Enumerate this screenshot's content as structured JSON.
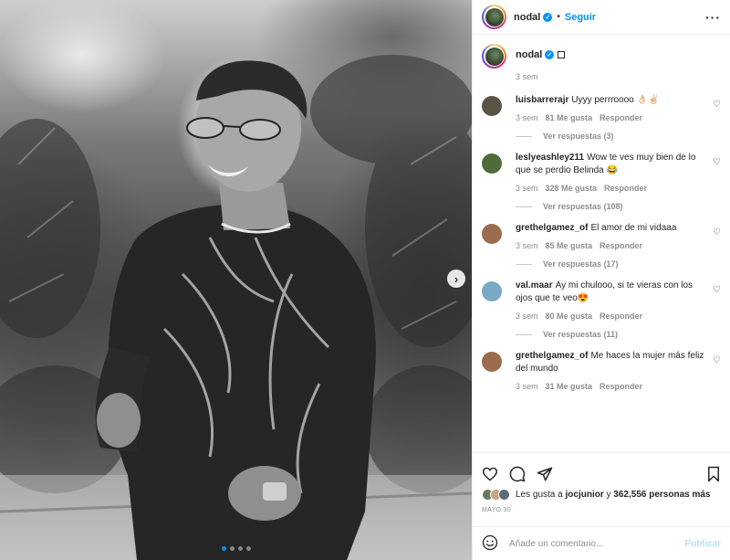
{
  "post": {
    "username": "nodal",
    "follow_label": "Seguir",
    "separator": "•",
    "more_label": "···",
    "caption_time": "3 sem"
  },
  "carousel": {
    "next_label": "›",
    "dots": 4,
    "active_dot": 0
  },
  "comments": [
    {
      "username": "luisbarrerajr",
      "text": "Uyyy perrroooo 👌🏻✌🏻",
      "time": "3 sem",
      "likes": "81 Me gusta",
      "reply_label": "Responder",
      "view_replies": "Ver respuestas (3)",
      "avatar_color": "#5b5346"
    },
    {
      "username": "leslyeashley211",
      "text": "Wow te ves muy bien de lo que se perdio Belinda 😂",
      "time": "3 sem",
      "likes": "328 Me gusta",
      "reply_label": "Responder",
      "view_replies": "Ver respuestas (108)",
      "avatar_color": "#4e6b3a"
    },
    {
      "username": "grethelgamez_of",
      "text": "El amor de mi vidaaa",
      "time": "3 sem",
      "likes": "85 Me gusta",
      "reply_label": "Responder",
      "view_replies": "Ver respuestas (17)",
      "avatar_color": "#9a6b4f"
    },
    {
      "username": "val.maar",
      "text": "Ay mi chulooo, si te vieras con los ojos que te veo😍",
      "time": "3 sem",
      "likes": "80 Me gusta",
      "reply_label": "Responder",
      "view_replies": "Ver respuestas (11)",
      "avatar_color": "#79a9c4"
    },
    {
      "username": "grethelgamez_of",
      "text": "Me haces la mujer más feliz del mundo",
      "time": "3 sem",
      "likes": "31 Me gusta",
      "reply_label": "Responder",
      "view_replies": "",
      "avatar_color": "#9a6b4f"
    }
  ],
  "likes": {
    "prefix": "Les gusta a",
    "user": "jocjunior",
    "middle": "y",
    "count": "362,556 personas más"
  },
  "date": "MAYO 30",
  "add_comment": {
    "placeholder": "Añade un comentario...",
    "post_label": "Publicar"
  },
  "icons": [
    "heart-icon",
    "comment-icon",
    "share-icon",
    "bookmark-icon",
    "emoji-icon"
  ],
  "colors": {
    "accent": "#0095f6",
    "muted": "#8e8e8e",
    "post_disabled": "#b2dffc"
  }
}
